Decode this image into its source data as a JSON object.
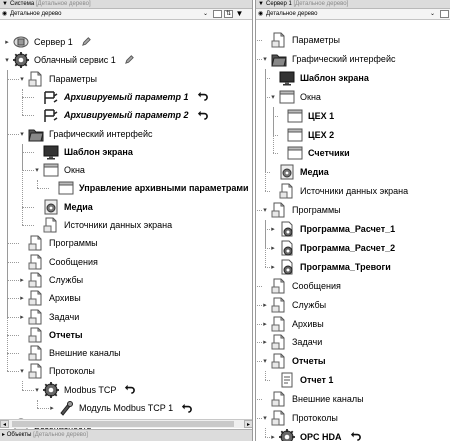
{
  "left_panel": {
    "title": "Система",
    "title_sub": "[Детальное дерево]",
    "view_select": "Детальное дерево",
    "tree": [
      {
        "label": "Сервер 1",
        "icon": "server-icon",
        "expander": "+",
        "extra": "pencil-icon",
        "style": ""
      },
      {
        "label": "Облачный сервис 1",
        "icon": "gear-icon",
        "expander": "-",
        "extra": "pencil-icon",
        "style": ""
      },
      {
        "label": "Параметры",
        "icon": "document-icon",
        "expander": "-",
        "extra": "",
        "style": ""
      },
      {
        "label": "Архивируемый параметр 1",
        "icon": "parameter-icon",
        "expander": "",
        "extra": "undo-arrow-icon",
        "style": "bi"
      },
      {
        "label": "Архивируемый параметр 2",
        "icon": "parameter-icon",
        "expander": "",
        "extra": "undo-arrow-icon",
        "style": "bi"
      },
      {
        "label": "Графический интерфейс",
        "icon": "folder-icon",
        "expander": "-",
        "extra": "",
        "style": ""
      },
      {
        "label": "Шаблон экрана",
        "icon": "monitor-icon",
        "expander": "",
        "extra": "",
        "style": "b"
      },
      {
        "label": "Окна",
        "icon": "window-icon",
        "expander": "-",
        "extra": "",
        "style": ""
      },
      {
        "label": "Управление архивными параметрами",
        "icon": "window-icon",
        "expander": "",
        "extra": "",
        "style": "b"
      },
      {
        "label": "Медиа",
        "icon": "media-icon",
        "expander": "",
        "extra": "",
        "style": "b"
      },
      {
        "label": "Источники данных экрана",
        "icon": "document-icon",
        "expander": "",
        "extra": "",
        "style": ""
      },
      {
        "label": "Программы",
        "icon": "document-icon",
        "expander": "",
        "extra": "",
        "style": ""
      },
      {
        "label": "Сообщения",
        "icon": "document-icon",
        "expander": "",
        "extra": "",
        "style": ""
      },
      {
        "label": "Службы",
        "icon": "document-icon",
        "expander": "+",
        "extra": "",
        "style": ""
      },
      {
        "label": "Архивы",
        "icon": "document-icon",
        "expander": "+",
        "extra": "",
        "style": ""
      },
      {
        "label": "Задачи",
        "icon": "document-icon",
        "expander": "+",
        "extra": "",
        "style": ""
      },
      {
        "label": "Отчеты",
        "icon": "document-icon",
        "expander": "",
        "extra": "",
        "style": "b"
      },
      {
        "label": "Внешние каналы",
        "icon": "document-icon",
        "expander": "",
        "extra": "",
        "style": ""
      },
      {
        "label": "Протоколы",
        "icon": "document-icon",
        "expander": "-",
        "extra": "",
        "style": ""
      },
      {
        "label": "Modbus TCP",
        "icon": "gear-icon",
        "expander": "-",
        "extra": "undo-arrow-icon",
        "style": ""
      },
      {
        "label": "Модуль Modbus TCP 1",
        "icon": "module-icon",
        "expander": "+",
        "extra": "undo-arrow-icon",
        "style": ""
      },
      {
        "label": "Безопасность",
        "icon": "lock-icon",
        "expander": "+",
        "extra": "",
        "style": ""
      }
    ]
  },
  "right_panel": {
    "title": "Сервер 1",
    "title_sub": "[Детальное дерево]",
    "view_select": "Детальное дерево",
    "tree": [
      {
        "label": "Параметры",
        "icon": "document-icon",
        "expander": "",
        "extra": "",
        "style": ""
      },
      {
        "label": "Графический интерфейс",
        "icon": "folder-icon",
        "expander": "-",
        "extra": "",
        "style": ""
      },
      {
        "label": "Шаблон экрана",
        "icon": "monitor-icon",
        "expander": "",
        "extra": "",
        "style": "b"
      },
      {
        "label": "Окна",
        "icon": "window-icon",
        "expander": "-",
        "extra": "",
        "style": ""
      },
      {
        "label": "ЦЕХ 1",
        "icon": "window-icon",
        "expander": "",
        "extra": "",
        "style": "b"
      },
      {
        "label": "ЦЕХ 2",
        "icon": "window-icon",
        "expander": "",
        "extra": "",
        "style": "b"
      },
      {
        "label": "Счетчики",
        "icon": "window-icon",
        "expander": "",
        "extra": "",
        "style": "b"
      },
      {
        "label": "Медиа",
        "icon": "media-icon",
        "expander": "",
        "extra": "",
        "style": "b"
      },
      {
        "label": "Источники данных экрана",
        "icon": "document-icon",
        "expander": "",
        "extra": "",
        "style": ""
      },
      {
        "label": "Программы",
        "icon": "document-icon",
        "expander": "-",
        "extra": "",
        "style": ""
      },
      {
        "label": "Программа_Расчет_1",
        "icon": "program-icon",
        "expander": "+",
        "extra": "",
        "style": "b"
      },
      {
        "label": "Программа_Расчет_2",
        "icon": "program-icon",
        "expander": "+",
        "extra": "",
        "style": "b"
      },
      {
        "label": "Программа_Тревоги",
        "icon": "program-icon",
        "expander": "+",
        "extra": "",
        "style": "b"
      },
      {
        "label": "Сообщения",
        "icon": "document-icon",
        "expander": "",
        "extra": "",
        "style": ""
      },
      {
        "label": "Службы",
        "icon": "document-icon",
        "expander": "+",
        "extra": "",
        "style": ""
      },
      {
        "label": "Архивы",
        "icon": "document-icon",
        "expander": "+",
        "extra": "",
        "style": ""
      },
      {
        "label": "Задачи",
        "icon": "document-icon",
        "expander": "+",
        "extra": "",
        "style": ""
      },
      {
        "label": "Отчеты",
        "icon": "document-icon",
        "expander": "-",
        "extra": "",
        "style": "b"
      },
      {
        "label": "Отчет 1",
        "icon": "report-icon",
        "expander": "",
        "extra": "",
        "style": "b"
      },
      {
        "label": "Внешние каналы",
        "icon": "document-icon",
        "expander": "",
        "extra": "",
        "style": ""
      },
      {
        "label": "Протоколы",
        "icon": "document-icon",
        "expander": "-",
        "extra": "",
        "style": ""
      },
      {
        "label": "OPC HDA",
        "icon": "gear-icon",
        "expander": "+",
        "extra": "undo-arrow-icon",
        "style": "b"
      }
    ]
  },
  "bottom_bar": {
    "title": "Объекты",
    "title_sub": "[Детальное дерево]"
  },
  "colors": {
    "header_bg": "#dcdcdc",
    "tree_line": "#9a9a9a",
    "icon_stroke": "#555555"
  }
}
